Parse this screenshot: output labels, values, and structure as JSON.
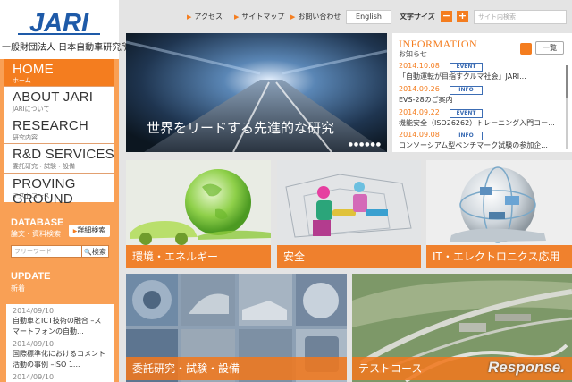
{
  "logo": {
    "text": "JARI",
    "subtitle": "一般財団法人 日本自動車研究所"
  },
  "nav": [
    {
      "label": "HOME",
      "sub": "ホーム"
    },
    {
      "label": "ABOUT JARI",
      "sub": "JARIについて"
    },
    {
      "label": "RESEARCH",
      "sub": "研究内容"
    },
    {
      "label": "R&D SERVICES",
      "sub": "委託研究・試験・設備"
    },
    {
      "label": "PROVING GROUND",
      "sub": "テストコース"
    }
  ],
  "database": {
    "title": "DATABASE",
    "sub": "論文・資料検索",
    "detail_button": "詳細検索",
    "placeholder": "フリーワード",
    "search_button": "検索"
  },
  "update": {
    "title": "UPDATE",
    "sub": "新着",
    "items": [
      {
        "date": "2014/09/10",
        "text1": "自動車とICT技術の融合 –ス",
        "text2": "マートフォンの自動..."
      },
      {
        "date": "2014/09/10",
        "text1": "国際標準化におけるコメント",
        "text2": "活動の事例 –ISO 1..."
      },
      {
        "date": "2014/09/10",
        "text1": "",
        "text2": ""
      }
    ]
  },
  "topbar": {
    "links": [
      "アクセス",
      "サイトマップ",
      "お問い合わせ"
    ],
    "english": "English",
    "fontsize_label": "文字サイズ",
    "minus": "−",
    "plus": "+",
    "search_placeholder": "サイト内検索"
  },
  "hero": {
    "caption": "世界をリードする先進的な研究",
    "dots": "●●●●●●"
  },
  "information": {
    "title": "INFORMATION",
    "sub": "お知らせ",
    "list_button": "一覧",
    "items": [
      {
        "date": "2014.10.08",
        "badge": "EVENT",
        "text": "「自動運転が目指すクルマ社会」JARI..."
      },
      {
        "date": "2014.09.26",
        "badge": "INFO",
        "text": "EVS-28のご案内"
      },
      {
        "date": "2014.09.22",
        "badge": "EVENT",
        "text": "機能安全（ISO26262）トレーニング入門コー..."
      },
      {
        "date": "2014.09.08",
        "badge": "INFO",
        "text": "コンソーシアム型ベンチマーク試験の参加企..."
      }
    ]
  },
  "tiles": [
    {
      "label": "環境・エネルギー"
    },
    {
      "label": "安全"
    },
    {
      "label": "IT・エレクトロニクス応用"
    },
    {
      "label": "委託研究・試験・設備"
    },
    {
      "label": "テストコース"
    }
  ],
  "watermark": "Response.",
  "colors": {
    "accent": "#f47d1f",
    "sidebar": "#f9a055",
    "badge": "#3c6db4"
  }
}
